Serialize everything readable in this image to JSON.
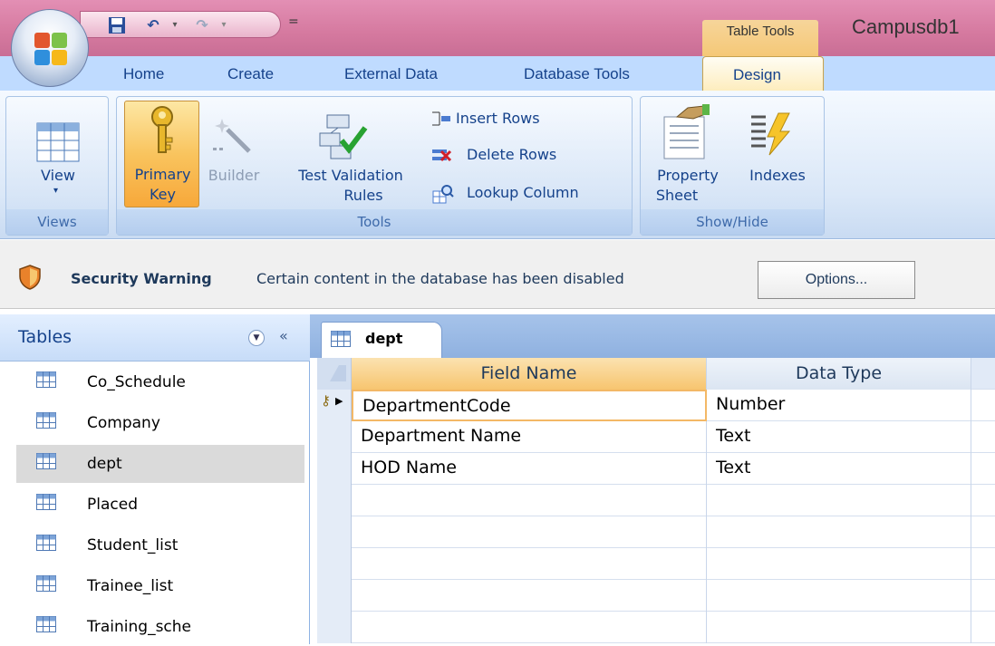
{
  "window": {
    "app_title": "Campusdb1",
    "context_tab_group": "Table Tools"
  },
  "quick_access": {
    "customize_glyph": "="
  },
  "tabs": [
    "Home",
    "Create",
    "External Data",
    "Database Tools",
    "Design"
  ],
  "ribbon": {
    "groups": {
      "views": "Views",
      "tools": "Tools",
      "show_hide": "Show/Hide"
    },
    "buttons": {
      "view": "View",
      "primary_key_l1": "Primary",
      "primary_key_l2": "Key",
      "builder": "Builder",
      "test_validation_l1": "Test Validation",
      "test_validation_l2": "Rules",
      "insert_rows": "Insert Rows",
      "delete_rows": "Delete Rows",
      "lookup_column": "Lookup Column",
      "property_sheet_l1": "Property",
      "property_sheet_l2": "Sheet",
      "indexes": "Indexes"
    }
  },
  "security_bar": {
    "title": "Security Warning",
    "message": "Certain content in the database has been disabled",
    "options_label": "Options..."
  },
  "nav_pane": {
    "title": "Tables",
    "collapse_glyph": "«",
    "items": [
      "Co_Schedule",
      "Company",
      "dept",
      "Placed",
      "Student_list",
      "Trainee_list",
      "Training_sche"
    ],
    "selected": "dept"
  },
  "document_tab": {
    "label": "dept"
  },
  "design_grid": {
    "headers": {
      "field_name": "Field Name",
      "data_type": "Data Type"
    },
    "rows": [
      {
        "field": "DepartmentCode",
        "type": "Number",
        "primary_key": true
      },
      {
        "field": "Department Name",
        "type": "Text"
      },
      {
        "field": "HOD Name",
        "type": "Text"
      }
    ]
  },
  "colors": {
    "title_bar": "#d5799f",
    "ribbon": "#dbe8f8",
    "accent": "#f5c877"
  }
}
